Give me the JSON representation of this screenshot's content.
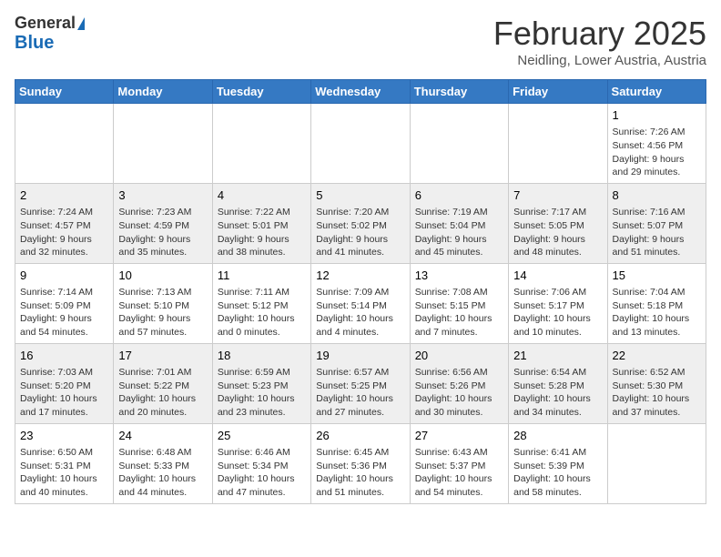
{
  "header": {
    "logo_line1": "General",
    "logo_line2": "Blue",
    "month_title": "February 2025",
    "location": "Neidling, Lower Austria, Austria"
  },
  "days_of_week": [
    "Sunday",
    "Monday",
    "Tuesday",
    "Wednesday",
    "Thursday",
    "Friday",
    "Saturday"
  ],
  "weeks": [
    [
      {
        "day": "",
        "info": ""
      },
      {
        "day": "",
        "info": ""
      },
      {
        "day": "",
        "info": ""
      },
      {
        "day": "",
        "info": ""
      },
      {
        "day": "",
        "info": ""
      },
      {
        "day": "",
        "info": ""
      },
      {
        "day": "1",
        "info": "Sunrise: 7:26 AM\nSunset: 4:56 PM\nDaylight: 9 hours and 29 minutes."
      }
    ],
    [
      {
        "day": "2",
        "info": "Sunrise: 7:24 AM\nSunset: 4:57 PM\nDaylight: 9 hours and 32 minutes."
      },
      {
        "day": "3",
        "info": "Sunrise: 7:23 AM\nSunset: 4:59 PM\nDaylight: 9 hours and 35 minutes."
      },
      {
        "day": "4",
        "info": "Sunrise: 7:22 AM\nSunset: 5:01 PM\nDaylight: 9 hours and 38 minutes."
      },
      {
        "day": "5",
        "info": "Sunrise: 7:20 AM\nSunset: 5:02 PM\nDaylight: 9 hours and 41 minutes."
      },
      {
        "day": "6",
        "info": "Sunrise: 7:19 AM\nSunset: 5:04 PM\nDaylight: 9 hours and 45 minutes."
      },
      {
        "day": "7",
        "info": "Sunrise: 7:17 AM\nSunset: 5:05 PM\nDaylight: 9 hours and 48 minutes."
      },
      {
        "day": "8",
        "info": "Sunrise: 7:16 AM\nSunset: 5:07 PM\nDaylight: 9 hours and 51 minutes."
      }
    ],
    [
      {
        "day": "9",
        "info": "Sunrise: 7:14 AM\nSunset: 5:09 PM\nDaylight: 9 hours and 54 minutes."
      },
      {
        "day": "10",
        "info": "Sunrise: 7:13 AM\nSunset: 5:10 PM\nDaylight: 9 hours and 57 minutes."
      },
      {
        "day": "11",
        "info": "Sunrise: 7:11 AM\nSunset: 5:12 PM\nDaylight: 10 hours and 0 minutes."
      },
      {
        "day": "12",
        "info": "Sunrise: 7:09 AM\nSunset: 5:14 PM\nDaylight: 10 hours and 4 minutes."
      },
      {
        "day": "13",
        "info": "Sunrise: 7:08 AM\nSunset: 5:15 PM\nDaylight: 10 hours and 7 minutes."
      },
      {
        "day": "14",
        "info": "Sunrise: 7:06 AM\nSunset: 5:17 PM\nDaylight: 10 hours and 10 minutes."
      },
      {
        "day": "15",
        "info": "Sunrise: 7:04 AM\nSunset: 5:18 PM\nDaylight: 10 hours and 13 minutes."
      }
    ],
    [
      {
        "day": "16",
        "info": "Sunrise: 7:03 AM\nSunset: 5:20 PM\nDaylight: 10 hours and 17 minutes."
      },
      {
        "day": "17",
        "info": "Sunrise: 7:01 AM\nSunset: 5:22 PM\nDaylight: 10 hours and 20 minutes."
      },
      {
        "day": "18",
        "info": "Sunrise: 6:59 AM\nSunset: 5:23 PM\nDaylight: 10 hours and 23 minutes."
      },
      {
        "day": "19",
        "info": "Sunrise: 6:57 AM\nSunset: 5:25 PM\nDaylight: 10 hours and 27 minutes."
      },
      {
        "day": "20",
        "info": "Sunrise: 6:56 AM\nSunset: 5:26 PM\nDaylight: 10 hours and 30 minutes."
      },
      {
        "day": "21",
        "info": "Sunrise: 6:54 AM\nSunset: 5:28 PM\nDaylight: 10 hours and 34 minutes."
      },
      {
        "day": "22",
        "info": "Sunrise: 6:52 AM\nSunset: 5:30 PM\nDaylight: 10 hours and 37 minutes."
      }
    ],
    [
      {
        "day": "23",
        "info": "Sunrise: 6:50 AM\nSunset: 5:31 PM\nDaylight: 10 hours and 40 minutes."
      },
      {
        "day": "24",
        "info": "Sunrise: 6:48 AM\nSunset: 5:33 PM\nDaylight: 10 hours and 44 minutes."
      },
      {
        "day": "25",
        "info": "Sunrise: 6:46 AM\nSunset: 5:34 PM\nDaylight: 10 hours and 47 minutes."
      },
      {
        "day": "26",
        "info": "Sunrise: 6:45 AM\nSunset: 5:36 PM\nDaylight: 10 hours and 51 minutes."
      },
      {
        "day": "27",
        "info": "Sunrise: 6:43 AM\nSunset: 5:37 PM\nDaylight: 10 hours and 54 minutes."
      },
      {
        "day": "28",
        "info": "Sunrise: 6:41 AM\nSunset: 5:39 PM\nDaylight: 10 hours and 58 minutes."
      },
      {
        "day": "",
        "info": ""
      }
    ]
  ]
}
